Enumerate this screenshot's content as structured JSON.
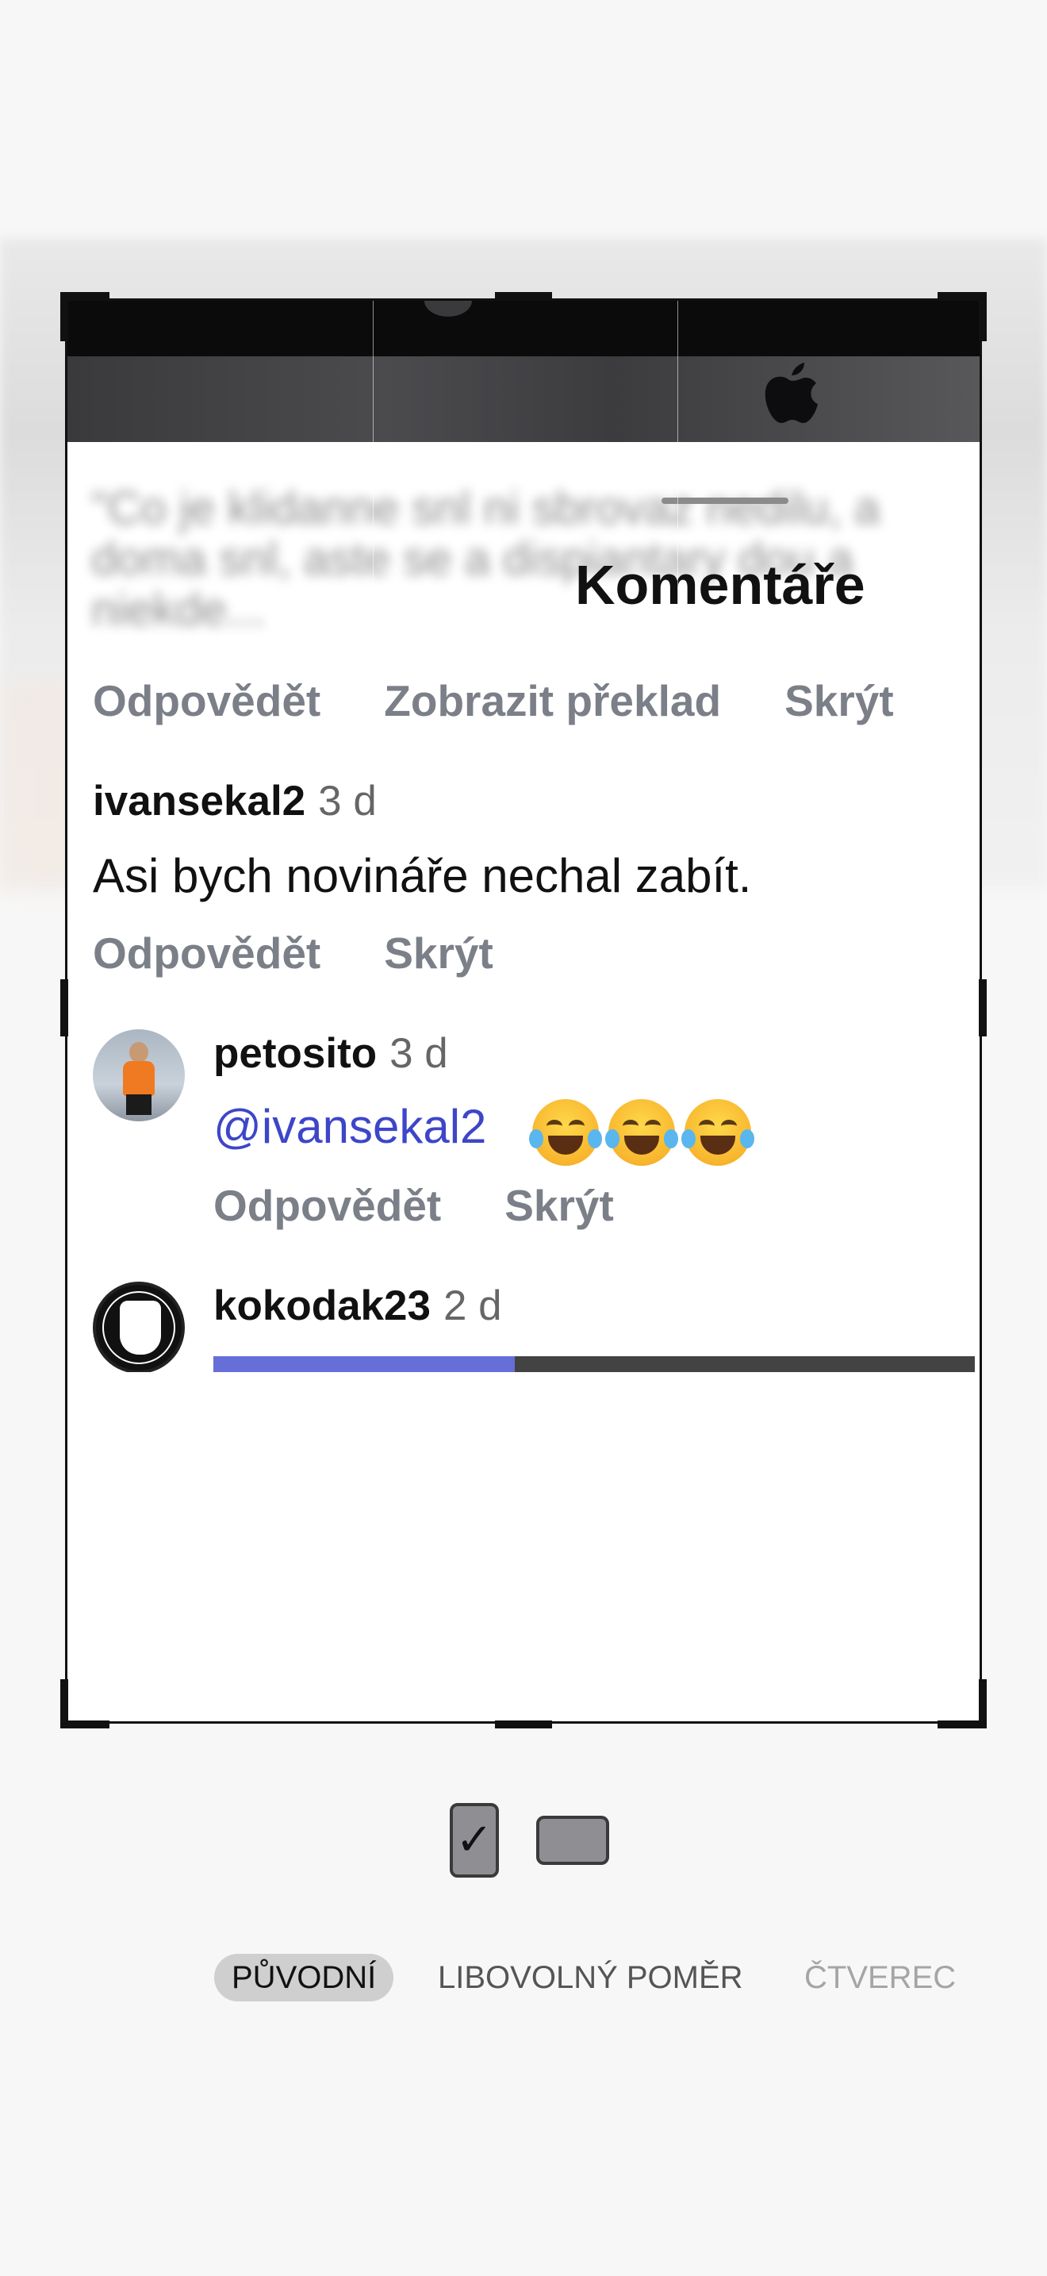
{
  "sheet": {
    "title": "Komentáře",
    "blurred_text": "\"Co je klidanne snl ni sbrovaz nedilu, a doma snl, aste se a dispiantary dou a niekde..."
  },
  "comments": [
    {
      "actions": [
        "Odpovědět",
        "Zobrazit překlad",
        "Skrýt"
      ]
    },
    {
      "username": "ivansekal2",
      "time": "3 d",
      "text": "Asi bych novináře nechal zabít.",
      "actions": [
        "Odpovědět",
        "Skrýt"
      ]
    },
    {
      "username": "petosito",
      "time": "3 d",
      "mention": "@ivansekal2",
      "emoji": "😂😂😂",
      "actions": [
        "Odpovědět",
        "Skrýt"
      ]
    },
    {
      "username": "kokodak23",
      "time": "2 d"
    }
  ],
  "orientation": {
    "portrait_check": "✓"
  },
  "aspect_ratios": [
    {
      "label": "PŮVODNÍ",
      "active": true
    },
    {
      "label": "LIBOVOLNÝ POMĚR",
      "active": false
    },
    {
      "label": "ČTVEREC",
      "active": false
    }
  ]
}
